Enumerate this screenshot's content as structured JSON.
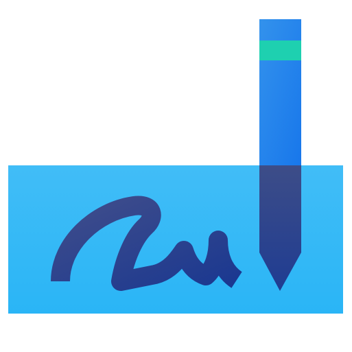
{
  "icon": {
    "name": "signature-icon",
    "colors": {
      "pad_top": "#41BDF7",
      "pad_bottom": "#2AB5F6",
      "pen_body_top": "#3392EC",
      "pen_body_bottom": "#1877EB",
      "pen_band": "#1ED0B0",
      "pen_tip_top": "#3D4D88",
      "pen_tip_bottom": "#1F3C92",
      "ink_top": "#3F4D8B",
      "ink_bottom": "#1B3890"
    }
  }
}
